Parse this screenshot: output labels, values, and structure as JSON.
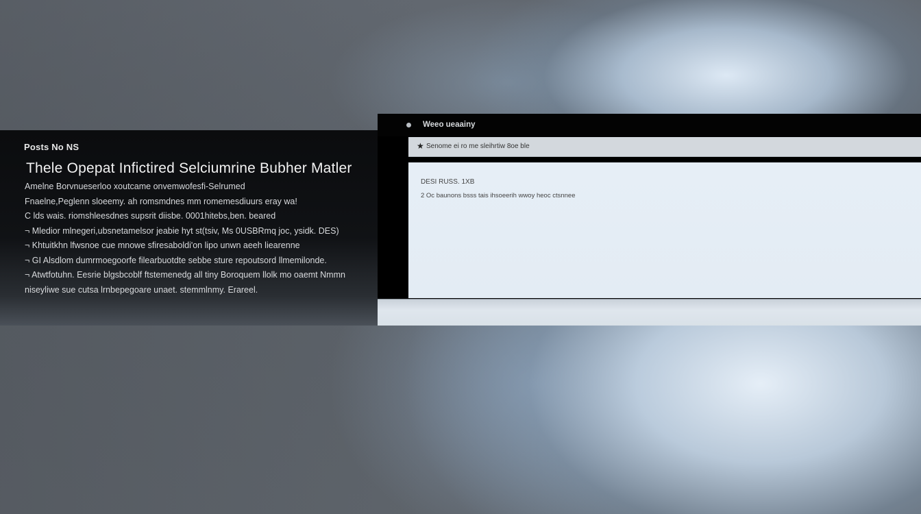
{
  "left_panel": {
    "eyebrow": "Posts No NS",
    "title": "Thele Opepat Infictired Selciumrine Bubher Matler",
    "lines": [
      "Amelne Borvnueserloo xoutcame onvemwofesfi-Selrumed",
      "Fnaelne,Peglenn sloeemy. ah romsmdnes mm romemesdiuurs eray wa!",
      "C lds wais. riomshleesdnes supsrit diisbe. 0001hitebs,ben. beared",
      "¬ Mledior mlnegeri,ubsnetamelsor jeabie hyt st(tsiv, Ms 0USBRmq joc, ysidk. DES)",
      "¬ Khtuitkhn lfwsnoe cue mnowe sfiresaboldi'on lipo unwn aeeh liearenne",
      "¬ GI Alsdlom dumrmoegoorfe filearbuotdte sebbe sture repoutsord llmemilonde.",
      "¬ Atwtfotuhn. Eesrie blgsbcoblf ftstemenedg all tiny Boroquem llolk mo oaemt Nmmn",
      "niseyliwe sue cutsa lrnbepegoare unaet. stemmlnmy. Erareel."
    ]
  },
  "window": {
    "title": "Weeo ueaainy",
    "toolbar_text": "Senome ei ro me sleihrtiw 8oe ble",
    "content_head": "DESI RUSS. 1XB",
    "content_row": "2 Oc baunons bsss tais ihsoeerih wwoy heoc ctsnnee",
    "icons": {
      "app": "app-icon",
      "toolbar": "star-icon"
    }
  }
}
